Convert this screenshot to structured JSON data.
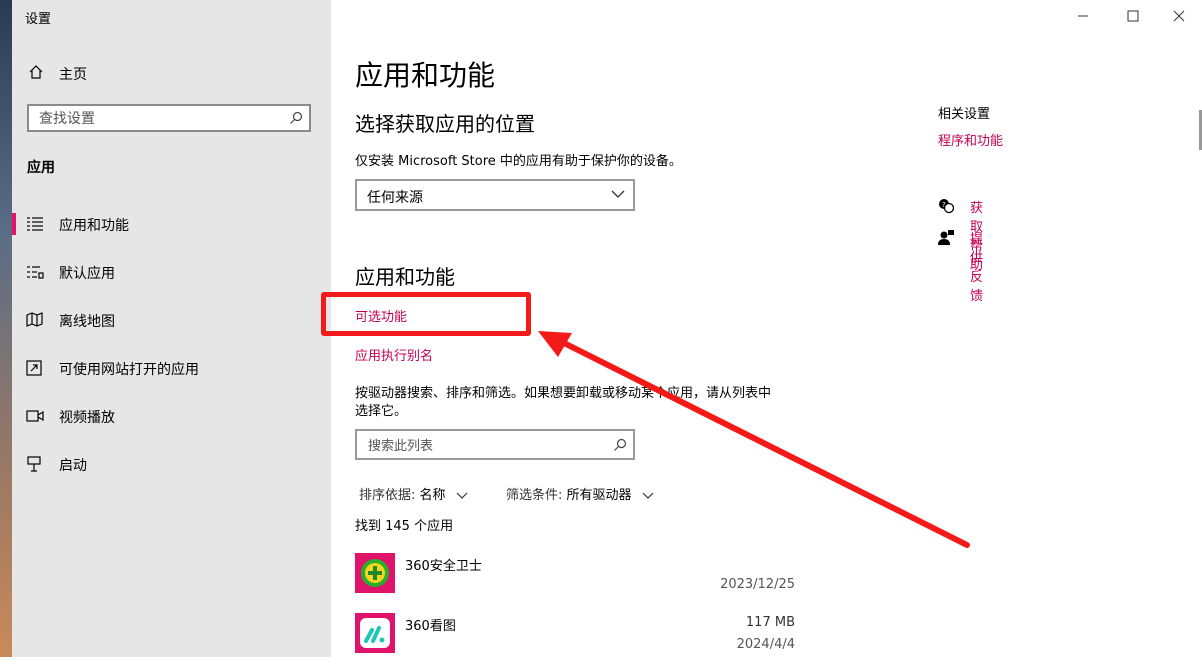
{
  "window": {
    "title": "设置"
  },
  "sidebar": {
    "home_label": "主页",
    "search_placeholder": "查找设置",
    "section_title": "应用",
    "items": [
      {
        "label": "应用和功能",
        "icon": "apps-features-icon",
        "active": true
      },
      {
        "label": "默认应用",
        "icon": "default-apps-icon",
        "active": false
      },
      {
        "label": "离线地图",
        "icon": "offline-maps-icon",
        "active": false
      },
      {
        "label": "可使用网站打开的应用",
        "icon": "apps-for-websites-icon",
        "active": false
      },
      {
        "label": "视频播放",
        "icon": "video-playback-icon",
        "active": false
      },
      {
        "label": "启动",
        "icon": "startup-icon",
        "active": false
      }
    ]
  },
  "main": {
    "page_title": "应用和功能",
    "install_section": {
      "title": "选择获取应用的位置",
      "description": "仅安装 Microsoft Store 中的应用有助于保护你的设备。",
      "dropdown_value": "任何来源"
    },
    "apps_section": {
      "title": "应用和功能",
      "optional_features_link": "可选功能",
      "app_alias_link": "应用执行别名",
      "description_line1": "按驱动器搜索、排序和筛选。如果想要卸载或移动某个应用，请从列表中",
      "description_line2": "选择它。",
      "search_placeholder": "搜索此列表",
      "sort_label": "排序依据:",
      "sort_value": "名称",
      "filter_label": "筛选条件:",
      "filter_value": "所有驱动器",
      "count_text": "找到 145 个应用",
      "apps": [
        {
          "name": "360安全卫士",
          "size": "",
          "date": "2023/12/25",
          "icon": "360-safe-icon"
        },
        {
          "name": "360看图",
          "size": "117 MB",
          "date": "2024/4/4",
          "icon": "360-image-viewer-icon"
        }
      ]
    }
  },
  "related": {
    "title": "相关设置",
    "link": "程序和功能",
    "help_label": "获取帮助",
    "feedback_label": "提供反馈"
  },
  "colors": {
    "accent": "#c30052",
    "annotation": "#f51a1a",
    "sidebar_bg": "#e6e6e6"
  }
}
